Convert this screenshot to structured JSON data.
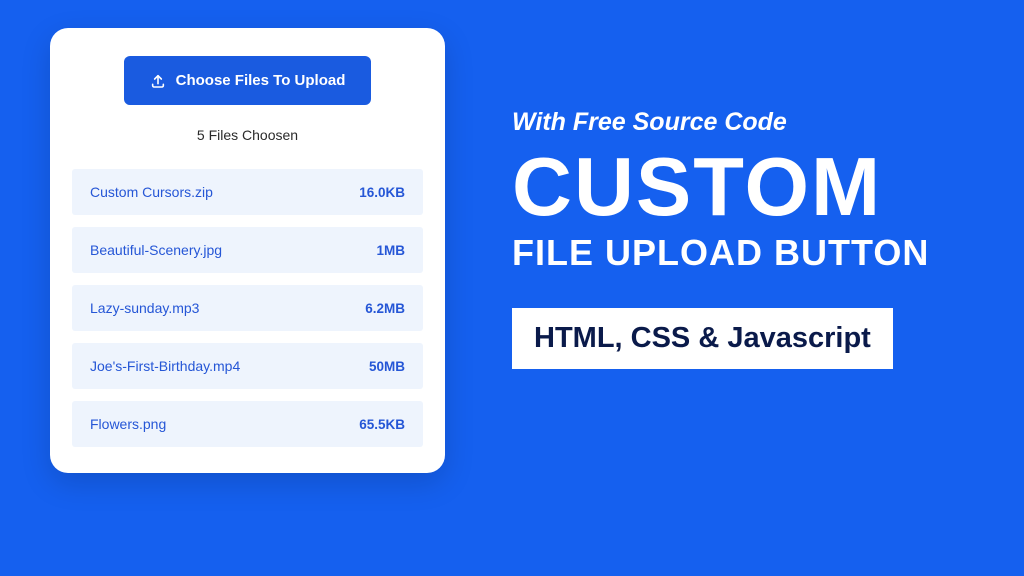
{
  "card": {
    "button_label": "Choose Files To Upload",
    "status_text": "5 Files Choosen",
    "files": [
      {
        "name": "Custom Cursors.zip",
        "size": "16.0KB"
      },
      {
        "name": "Beautiful-Scenery.jpg",
        "size": "1MB"
      },
      {
        "name": "Lazy-sunday.mp3",
        "size": "6.2MB"
      },
      {
        "name": "Joe's-First-Birthday.mp4",
        "size": "50MB"
      },
      {
        "name": "Flowers.png",
        "size": "65.5KB"
      }
    ]
  },
  "promo": {
    "kicker": "With Free Source Code",
    "title": "CUSTOM",
    "subtitle": "FILE UPLOAD BUTTON",
    "tag": "HTML, CSS & Javascript"
  },
  "colors": {
    "background": "#1560ef",
    "accent": "#1a5be0",
    "row_bg": "#eef4fd",
    "row_text": "#2556d6"
  }
}
